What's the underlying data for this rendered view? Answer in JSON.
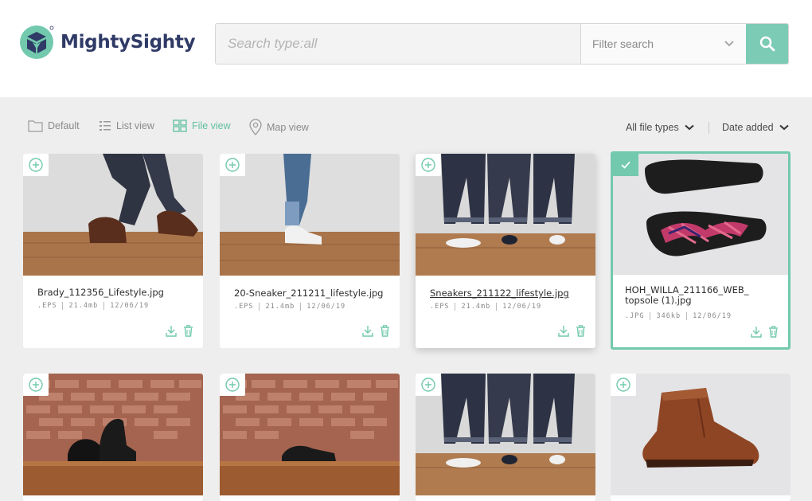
{
  "brand": {
    "name": "MightySighty",
    "primary": "#2f3a66",
    "accent": "#72c9ad"
  },
  "search": {
    "placeholder": "Search type:all",
    "filter_placeholder": "Filter search",
    "button_icon": "search-icon"
  },
  "toolbar": {
    "views": [
      {
        "label": "Default",
        "icon": "folder-icon",
        "active": false
      },
      {
        "label": "List view",
        "icon": "list-icon",
        "active": false
      },
      {
        "label": "File view",
        "icon": "grid-icon",
        "active": true
      },
      {
        "label": "Map view",
        "icon": "map-pin-icon",
        "active": false
      }
    ],
    "filter_label": "All file types",
    "sort_label": "Date added"
  },
  "files": [
    {
      "name": "Brady_112356_Lifestyle.jpg",
      "type": ".EPS",
      "size": "21.4mb",
      "date": "12/06/19",
      "state": "normal"
    },
    {
      "name": "20-Sneaker_211211_lifestyle.jpg",
      "type": ".EPS",
      "size": "21.4mb",
      "date": "12/06/19",
      "state": "normal"
    },
    {
      "name": "Sneakers_211122_lifestyle.jpg",
      "type": ".EPS",
      "size": "21.4mb",
      "date": "12/06/19",
      "state": "hover"
    },
    {
      "name": "HOH_WILLA_211166_WEB_ topsole (1).jpg",
      "type": ".JPG",
      "size": "346kb",
      "date": "12/06/19",
      "state": "selected"
    }
  ],
  "second_row_count": 4
}
